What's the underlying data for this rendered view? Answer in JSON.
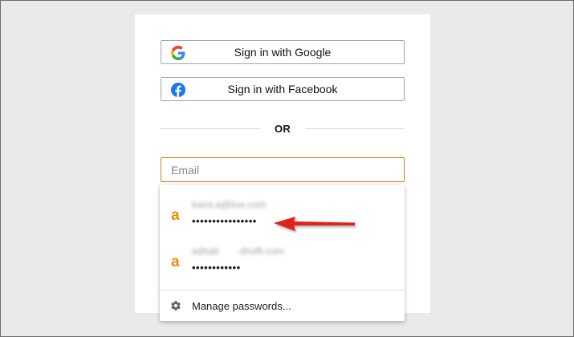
{
  "sso": {
    "google_label": "Sign in with Google",
    "facebook_label": "Sign in with Facebook",
    "google_icon": "google-g-icon",
    "facebook_icon": "facebook-f-icon"
  },
  "divider": {
    "text": "OR"
  },
  "email": {
    "placeholder": "Email",
    "value": "",
    "border_color": "#e47911"
  },
  "autofill": {
    "credentials": [
      {
        "username_part1": "kamLa@live.com",
        "username_part2": "",
        "password_mask": "••••••••••••••••",
        "site_icon": "amazon-a-icon"
      },
      {
        "username_part1": "adhab",
        "username_part2": "dhoffi.com",
        "password_mask": "••••••••••••",
        "site_icon": "amazon-a-icon"
      }
    ],
    "manage_label": "Manage passwords...",
    "manage_icon": "gear-icon"
  },
  "colors": {
    "accent_orange": "#e47911",
    "amazon_orange": "#f08804",
    "arrow_red": "#e0201b",
    "facebook_blue": "#1877f2"
  }
}
